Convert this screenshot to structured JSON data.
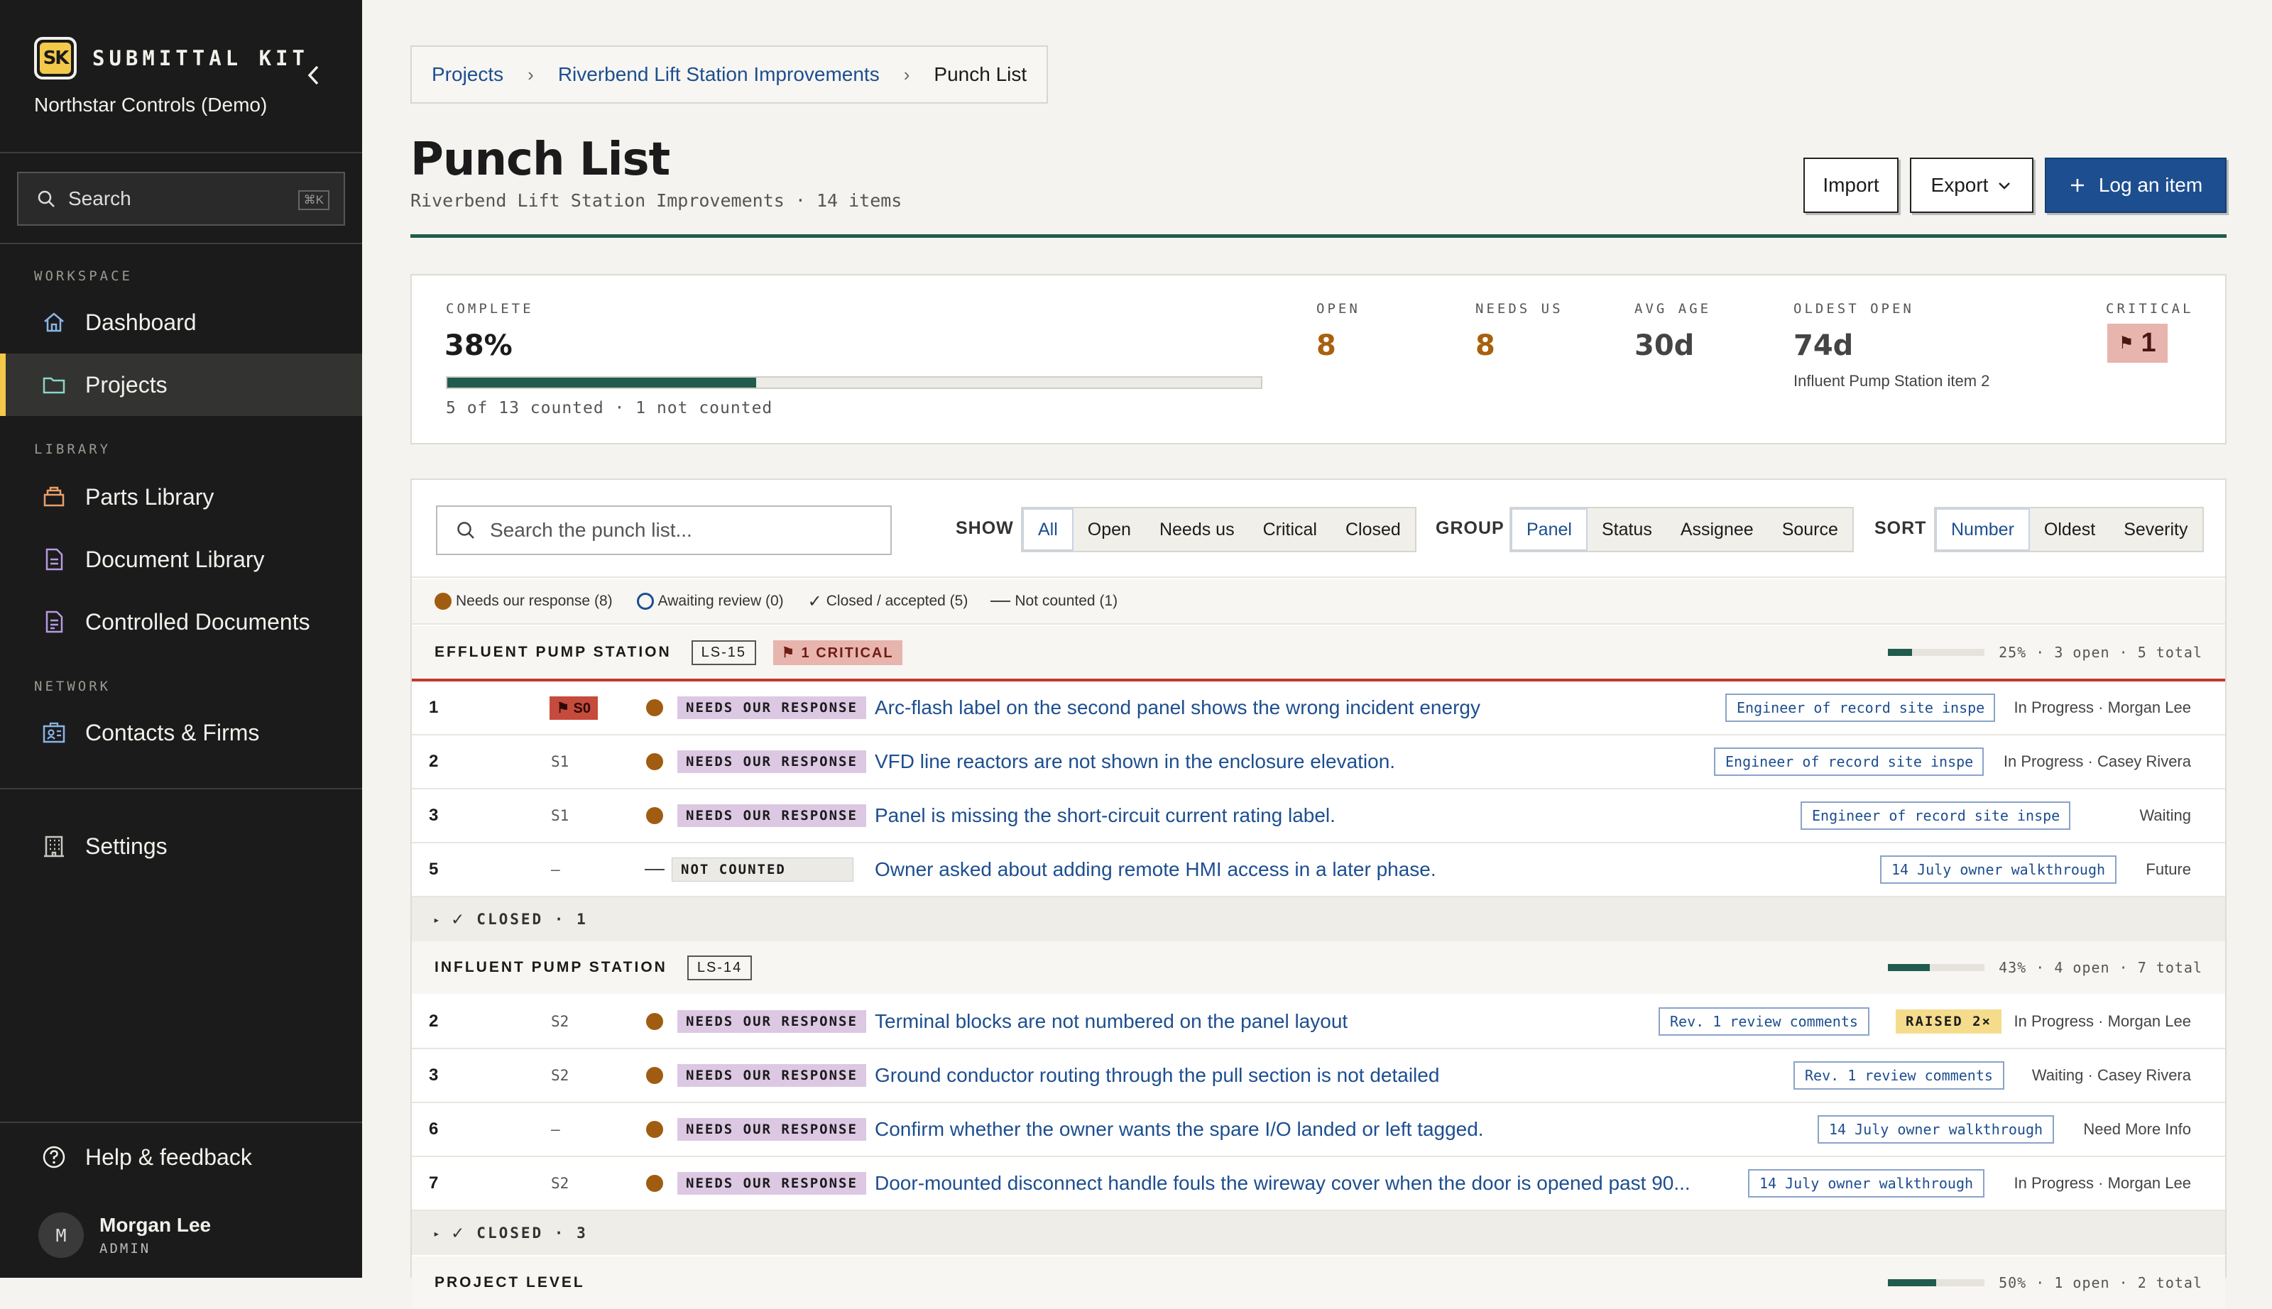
{
  "sidebar": {
    "brand_logo": "SK",
    "brand": "SUBMITTAL KIT",
    "org": "Northstar Controls (Demo)",
    "search_placeholder": "Search",
    "search_kbd": "⌘K",
    "sections": {
      "workspace": "WORKSPACE",
      "library": "LIBRARY",
      "network": "NETWORK"
    },
    "items": {
      "dashboard": "Dashboard",
      "projects": "Projects",
      "parts": "Parts Library",
      "documents": "Document Library",
      "controlled": "Controlled Documents",
      "contacts": "Contacts & Firms",
      "settings": "Settings",
      "help": "Help & feedback"
    },
    "user": {
      "initial": "M",
      "name": "Morgan Lee",
      "role": "ADMIN"
    }
  },
  "breadcrumb": {
    "root": "Projects",
    "project": "Riverbend Lift Station Improvements",
    "current": "Punch List"
  },
  "header": {
    "title": "Punch List",
    "subtitle": "Riverbend Lift Station Improvements · 14 items",
    "import": "Import",
    "export": "Export",
    "log": "Log an item"
  },
  "stats": {
    "complete_label": "COMPLETE",
    "complete_value": "38%",
    "complete_fraction": 0.38,
    "complete_note": "5 of 13 counted · 1 not counted",
    "open_label": "OPEN",
    "open_value": "8",
    "needs_label": "NEEDS US",
    "needs_value": "8",
    "age_label": "AVG AGE",
    "age_value": "30d",
    "oldest_label": "OLDEST OPEN",
    "oldest_value": "74d",
    "oldest_note": "Influent Pump Station item 2",
    "critical_label": "CRITICAL",
    "critical_value": "1"
  },
  "toolbar": {
    "search_placeholder": "Search the punch list...",
    "show_label": "SHOW",
    "show": [
      "All",
      "Open",
      "Needs us",
      "Critical",
      "Closed"
    ],
    "group_label": "GROUP",
    "group": [
      "Panel",
      "Status",
      "Assignee",
      "Source"
    ],
    "sort_label": "SORT",
    "sort": [
      "Number",
      "Oldest",
      "Severity"
    ]
  },
  "legend": [
    "Needs our response (8)",
    "Awaiting review (0)",
    "Closed / accepted (5)",
    "Not counted (1)"
  ],
  "groups": [
    {
      "name": "EFFLUENT PUMP STATION",
      "tag": "LS-15",
      "critical": "1 CRITICAL",
      "progress": "25% · 3 open · 5 total",
      "fraction": 0.25,
      "rows": [
        {
          "num": "1",
          "sev": "S0",
          "status": "NEEDS OUR RESPONSE",
          "title": "Arc-flash label on the second panel shows the wrong incident energy",
          "source": "Engineer of record site inspe",
          "assign": "In Progress · Morgan Lee"
        },
        {
          "num": "2",
          "sev": "S1",
          "status": "NEEDS OUR RESPONSE",
          "title": "VFD line reactors are not shown in the enclosure elevation.",
          "source": "Engineer of record site inspe",
          "assign": "In Progress · Casey Rivera"
        },
        {
          "num": "3",
          "sev": "S1",
          "status": "NEEDS OUR RESPONSE",
          "title": "Panel is missing the short-circuit current rating label.",
          "source": "Engineer of record site inspe",
          "assign": "Waiting"
        },
        {
          "num": "5",
          "sev": "–",
          "status": "NOT COUNTED",
          "title": "Owner asked about adding remote HMI access in a later phase.",
          "source": "14 July owner walkthrough",
          "assign": "Future"
        }
      ],
      "closed": "CLOSED · 1"
    },
    {
      "name": "INFLUENT PUMP STATION",
      "tag": "LS-14",
      "progress": "43% · 4 open · 7 total",
      "fraction": 0.43,
      "rows": [
        {
          "num": "2",
          "sev": "S2",
          "status": "NEEDS OUR RESPONSE",
          "title": "Terminal blocks are not numbered on the panel layout",
          "source": "Rev. 1 review comments",
          "raised": "RAISED 2×",
          "assign": "In Progress · Morgan Lee"
        },
        {
          "num": "3",
          "sev": "S2",
          "status": "NEEDS OUR RESPONSE",
          "title": "Ground conductor routing through the pull section is not detailed",
          "source": "Rev. 1 review comments",
          "assign": "Waiting · Casey Rivera"
        },
        {
          "num": "6",
          "sev": "–",
          "status": "NEEDS OUR RESPONSE",
          "title": "Confirm whether the owner wants the spare I/O landed or left tagged.",
          "source": "14 July owner walkthrough",
          "assign": "Need More Info"
        },
        {
          "num": "7",
          "sev": "S2",
          "status": "NEEDS OUR RESPONSE",
          "title": "Door-mounted disconnect handle fouls the wireway cover when the door is opened past 90...",
          "source": "14 July owner walkthrough",
          "assign": "In Progress · Morgan Lee"
        }
      ],
      "closed": "CLOSED · 3"
    },
    {
      "name": "PROJECT LEVEL",
      "progress": "50% · 1 open · 2 total",
      "fraction": 0.5
    }
  ],
  "colors": {
    "accent": "#1d4e8f",
    "brand": "#f3c94a",
    "progress": "#1f5c4e",
    "critical": "#c0392b",
    "needs": "#a05c10"
  }
}
